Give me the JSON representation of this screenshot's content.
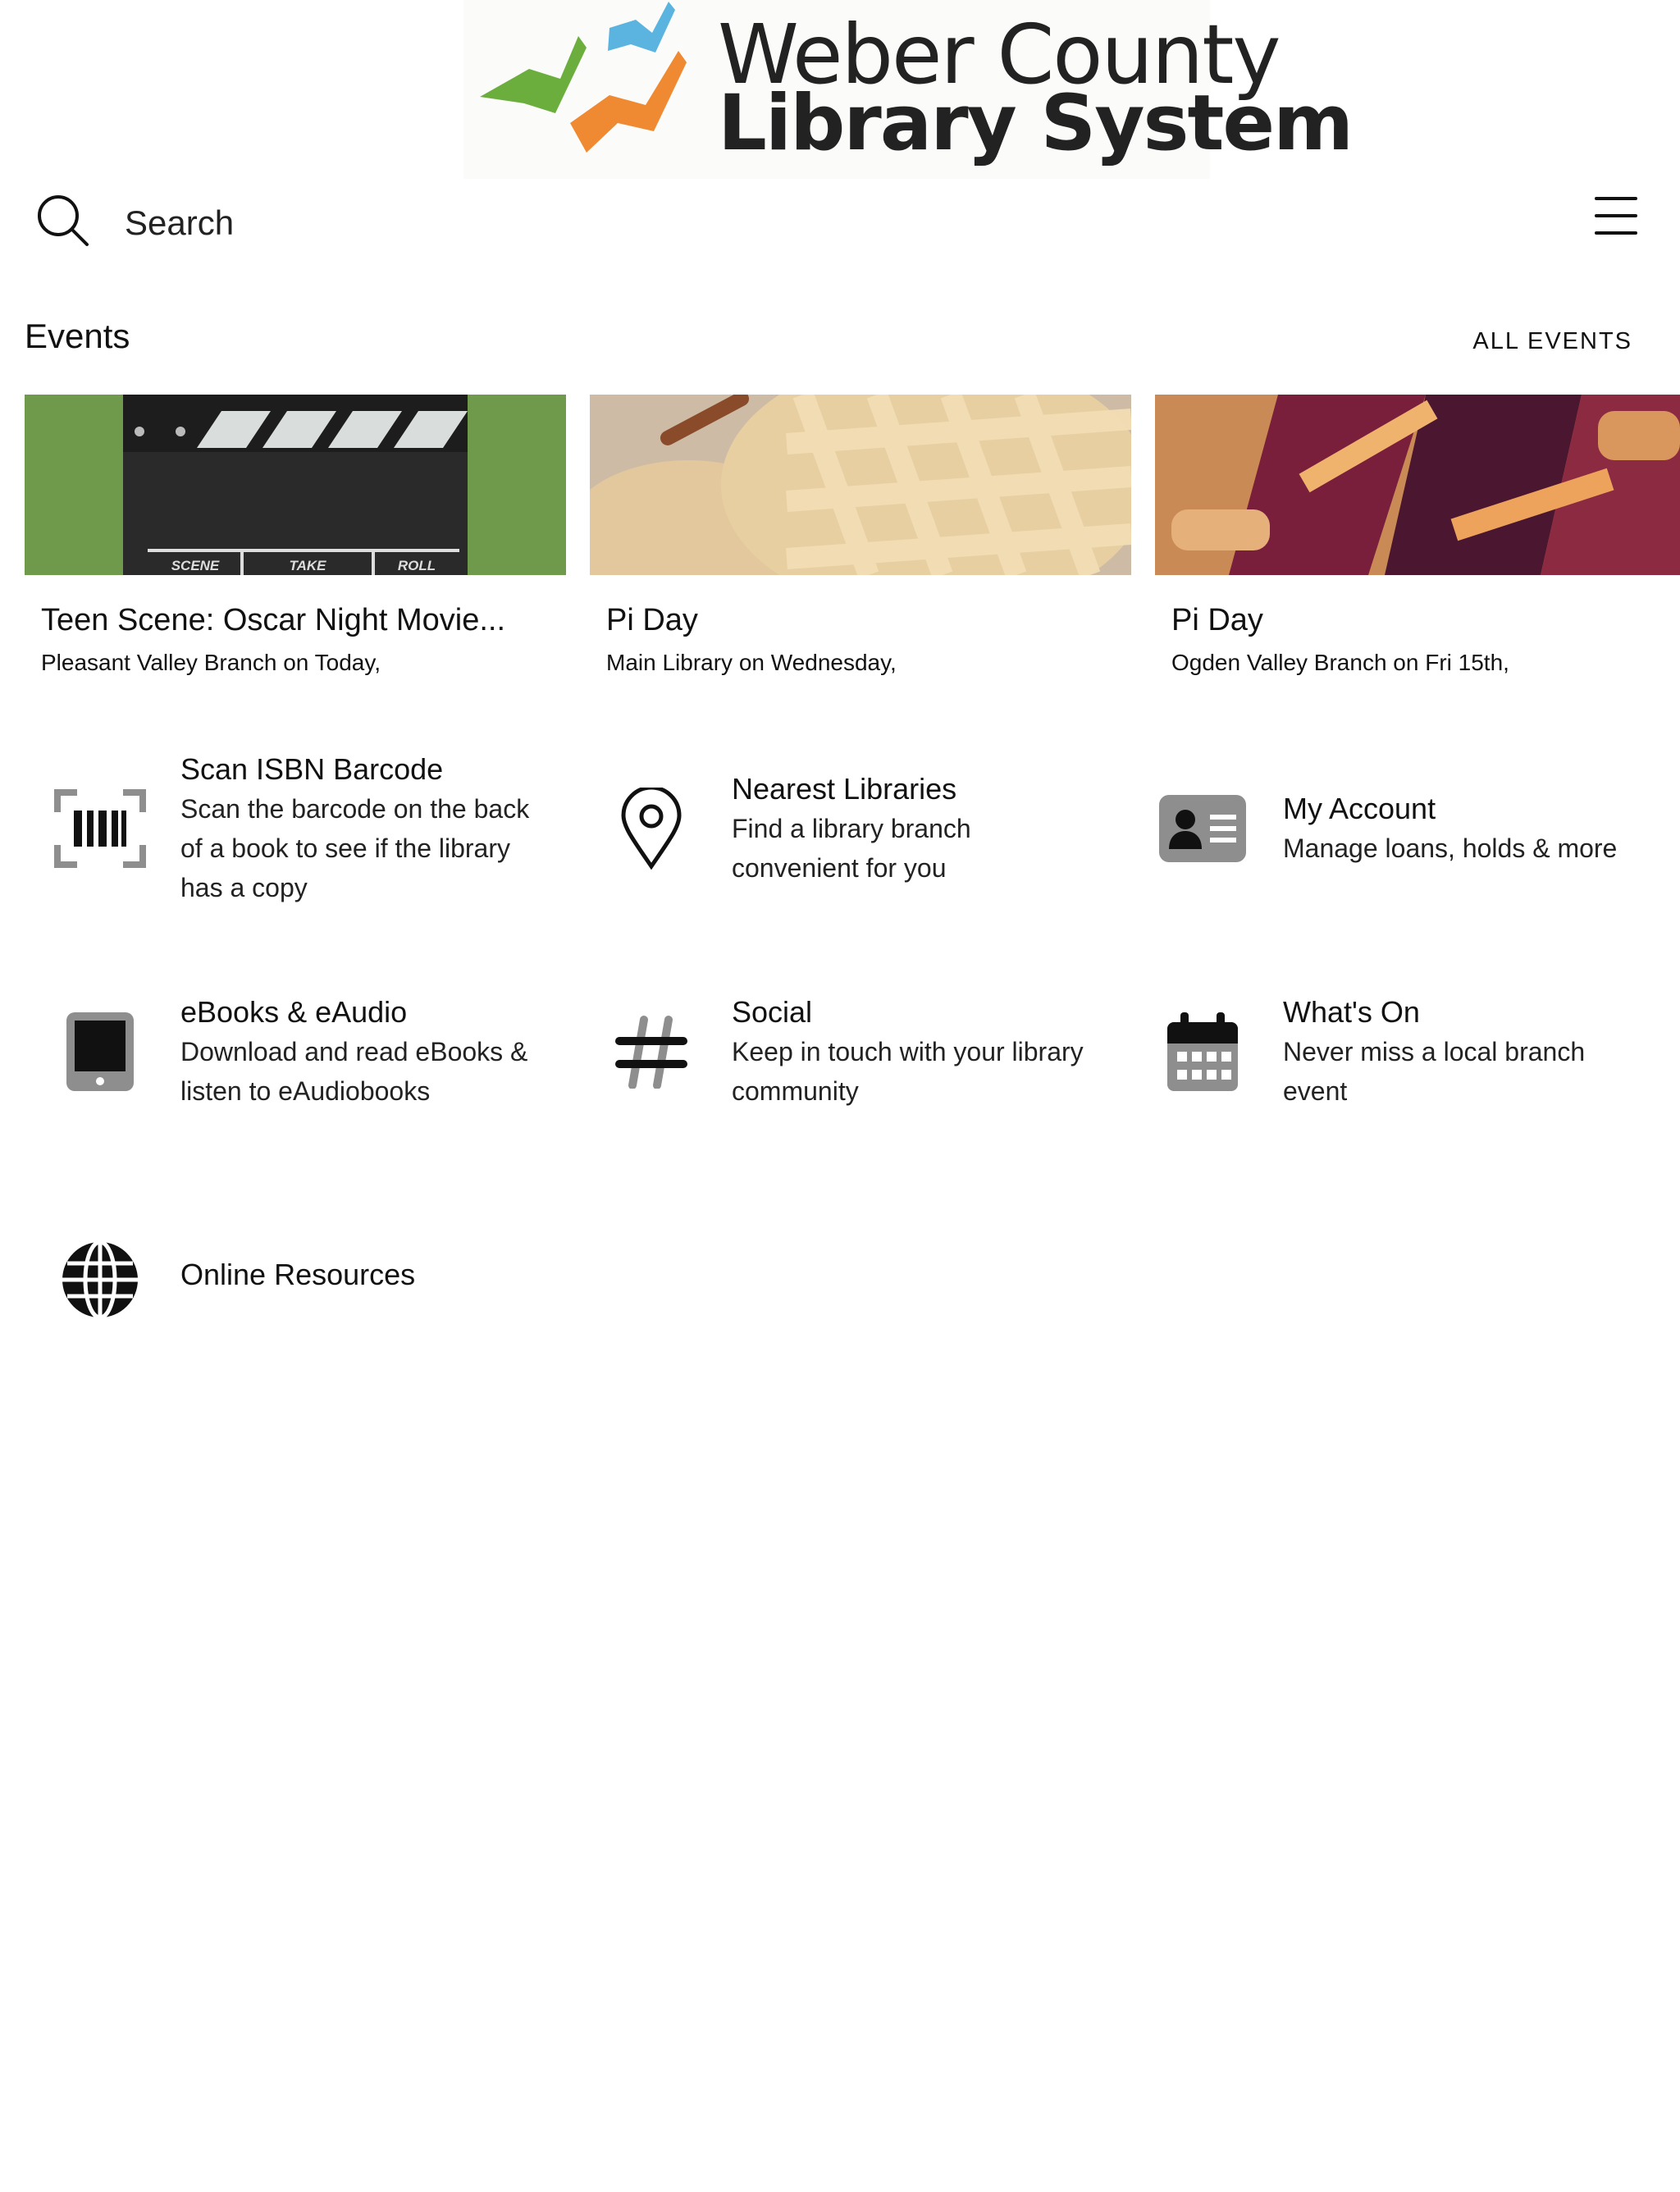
{
  "header": {
    "logo_line1": "Weber County",
    "logo_line2": "Library System"
  },
  "search": {
    "placeholder": "Search",
    "icon": "search-icon"
  },
  "menu": {
    "icon": "hamburger-menu-icon"
  },
  "events": {
    "title": "Events",
    "all_label": "ALL EVENTS",
    "items": [
      {
        "title": "Teen Scene: Oscar Night Movie...",
        "subtitle": "Pleasant Valley Branch on Today,",
        "image": "clapperboard-photo",
        "clap_labels": [
          "SCENE",
          "TAKE",
          "ROLL"
        ]
      },
      {
        "title": "Pi Day",
        "subtitle": "Main Library on Wednesday,",
        "image": "lattice-pie-photo"
      },
      {
        "title": "Pi Day",
        "subtitle": "Ogden Valley Branch on Fri 15th,",
        "image": "berry-pie-photo"
      }
    ]
  },
  "tiles": [
    {
      "title": "Scan ISBN Barcode",
      "desc": [
        "Scan the barcode on the back",
        "of a book to see if the library",
        "has a copy"
      ],
      "icon": "barcode-scan-icon"
    },
    {
      "title": "Nearest Libraries",
      "desc": [
        "Find a library branch",
        "convenient for you"
      ],
      "icon": "map-pin-icon"
    },
    {
      "title": "My Account",
      "desc": [
        "Manage loans, holds & more"
      ],
      "icon": "id-card-icon"
    },
    {
      "title": "eBooks & eAudio",
      "desc": [
        "Download and read eBooks &",
        "listen to eAudiobooks"
      ],
      "icon": "tablet-icon"
    },
    {
      "title": "Social",
      "desc": [
        "Keep in touch with your library",
        "community"
      ],
      "icon": "hashtag-icon"
    },
    {
      "title": "What's On",
      "desc": [
        "Never miss a local branch",
        "event"
      ],
      "icon": "calendar-icon"
    },
    {
      "title": "Online Resources",
      "desc": [],
      "icon": "globe-icon"
    }
  ],
  "colors": {
    "logo_green": "#6cae3e",
    "logo_blue": "#5bb3e0",
    "logo_orange": "#ef8a32",
    "icon_gray": "#8e8e8e"
  }
}
